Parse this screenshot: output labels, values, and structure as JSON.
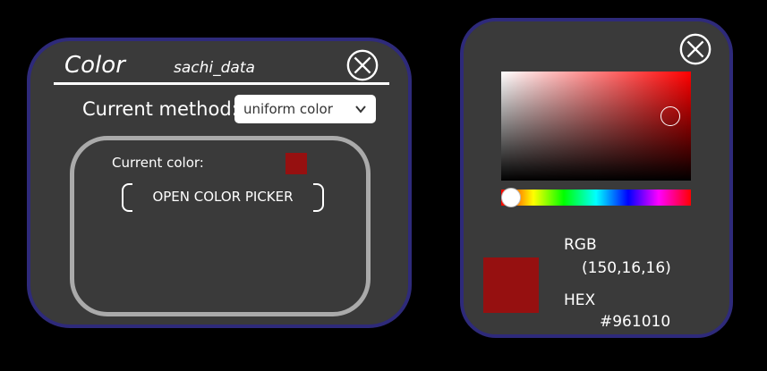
{
  "color_panel": {
    "title": "Color",
    "dataset": "sachi_data",
    "method_label": "Current method:",
    "method_value": "uniform color",
    "current_color_label": "Current color:",
    "current_color": "#961010",
    "open_picker_label": "OPEN COLOR PICKER",
    "close_icon": "close-circle-x-icon"
  },
  "picker_panel": {
    "hue": 0,
    "saturation": 0.89,
    "value": 0.59,
    "rgb_label": "RGB",
    "rgb_value": "(150,16,16)",
    "hex_label": "HEX",
    "hex_value": "#961010",
    "preview_color": "#961010",
    "close_icon": "close-circle-x-icon"
  },
  "colors": {
    "panel_bg": "#3a3a3a",
    "panel_border": "#2e2a7a",
    "frame_border": "#aaaaaa"
  }
}
